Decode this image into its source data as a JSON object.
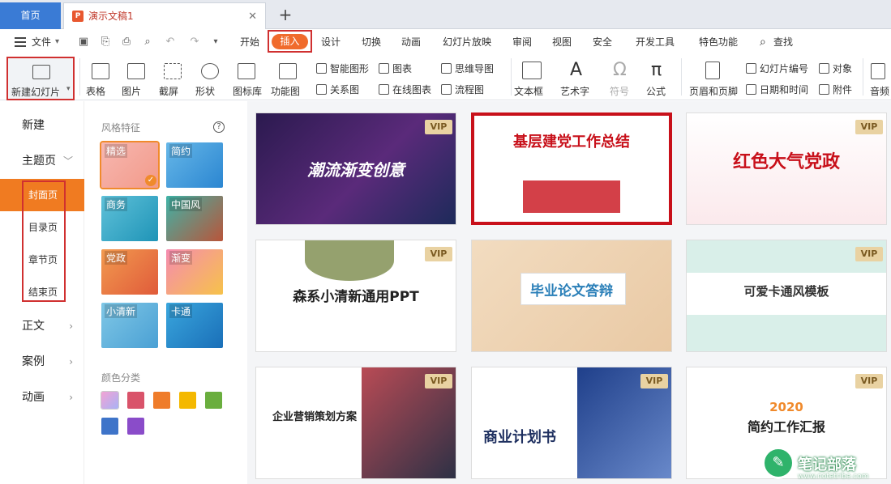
{
  "tabs": {
    "home": "首页",
    "document": "演示文稿1",
    "close_glyph": "✕",
    "add_glyph": "+"
  },
  "menu": {
    "file": "文件",
    "items": [
      "开始",
      "插入",
      "设计",
      "切换",
      "动画",
      "幻灯片放映",
      "审阅",
      "视图",
      "安全",
      "开发工具",
      "特色功能"
    ],
    "active": "插入",
    "search": "查找"
  },
  "ribbon": {
    "new_slide": "新建幻灯片",
    "table": "表格",
    "picture": "图片",
    "screenshot": "截屏",
    "shape": "形状",
    "icon_lib": "图标库",
    "function_chart": "功能图",
    "smart_shape": "智能图形",
    "chart": "图表",
    "mind_map": "思维导图",
    "relation_chart": "关系图",
    "online_chart": "在线图表",
    "flowchart": "流程图",
    "textbox": "文本框",
    "art_text": "艺术字",
    "symbol": "符号",
    "formula": "公式",
    "header_footer": "页眉和页脚",
    "slide_number": "幻灯片编号",
    "object": "对象",
    "date_time": "日期和时间",
    "attachment": "附件",
    "audio": "音频"
  },
  "leftnav": {
    "new": "新建",
    "theme_page": "主题页",
    "sub": [
      "封面页",
      "目录页",
      "章节页",
      "结束页"
    ],
    "body": "正文",
    "case": "案例",
    "animation": "动画"
  },
  "style_panel": {
    "title": "风格特征",
    "help": "?",
    "styles": [
      "精选",
      "简约",
      "商务",
      "中国风",
      "党政",
      "渐变",
      "小清新",
      "卡通"
    ],
    "color_title": "颜色分类",
    "colors": [
      "#cfa0f0",
      "#d9536a",
      "#ef7c2a",
      "#f4b800",
      "#6aae3e",
      "#3e74c9",
      "#8a4cc9"
    ]
  },
  "templates": [
    {
      "title": "潮流渐变创意",
      "vip": "VIP"
    },
    {
      "title": "基层建党工作总结",
      "vip": ""
    },
    {
      "title": "红色大气党政",
      "vip": "VIP"
    },
    {
      "title": "森系小清新通用PPT",
      "vip": "VIP"
    },
    {
      "title": "毕业论文答辩",
      "vip": ""
    },
    {
      "title": "可爱卡通风模板",
      "vip": "VIP"
    },
    {
      "title": "企业营销策划方案",
      "vip": "VIP"
    },
    {
      "title": "商业计划书",
      "vip": "VIP"
    },
    {
      "title": "简约工作汇报",
      "vip": "VIP",
      "year": "2020"
    }
  ],
  "watermark": {
    "text": "笔记部落",
    "url": "www.notetribe.com"
  }
}
